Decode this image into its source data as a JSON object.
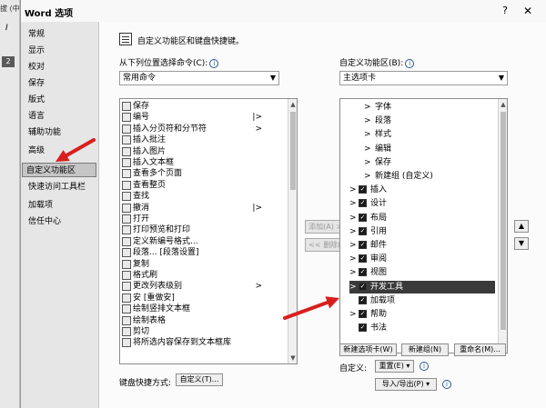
{
  "background_app": {
    "title_fragment": "拔 (中",
    "ruler_mark": "2",
    "side_label": "I"
  },
  "dialog": {
    "title": "Word 选项",
    "help_label": "?",
    "close_label": "✕"
  },
  "nav": {
    "items": [
      {
        "label": "常规"
      },
      {
        "label": "显示"
      },
      {
        "label": "校对"
      },
      {
        "label": "保存"
      },
      {
        "label": "版式"
      },
      {
        "label": "语言"
      },
      {
        "label": "辅助功能"
      },
      {
        "label": "高级"
      },
      {
        "label": "自定义功能区"
      },
      {
        "label": "快速访问工具栏"
      },
      {
        "label": "加载项"
      },
      {
        "label": "信任中心"
      }
    ],
    "active_label": "自定义功能区"
  },
  "main": {
    "header": "自定义功能区和键盘快捷键。",
    "choose_from_label": "从下列位置选择命令(C):",
    "choose_from_value": "常用命令",
    "customize_label": "自定义功能区(B):",
    "customize_value": "主选项卡",
    "info_icon": "i"
  },
  "commands": [
    {
      "label": "保存",
      "sub": ""
    },
    {
      "label": "编号",
      "sub": "|>"
    },
    {
      "label": "插入分页符和分节符",
      "sub": ">"
    },
    {
      "label": "插入批注",
      "sub": ""
    },
    {
      "label": "插入图片",
      "sub": ""
    },
    {
      "label": "插入文本框",
      "sub": ""
    },
    {
      "label": "查看多个页面",
      "sub": ""
    },
    {
      "label": "查看整页",
      "sub": ""
    },
    {
      "label": "查找",
      "sub": ""
    },
    {
      "label": "撤消",
      "sub": "|>"
    },
    {
      "label": "打开",
      "sub": ""
    },
    {
      "label": "打印预览和打印",
      "sub": ""
    },
    {
      "label": "定义新编号格式...",
      "sub": ""
    },
    {
      "label": "段落... [段落设置]",
      "sub": ""
    },
    {
      "label": "复制",
      "sub": ""
    },
    {
      "label": "格式刷",
      "sub": ""
    },
    {
      "label": "更改列表级别",
      "sub": ">"
    },
    {
      "label": "安 [重做安]",
      "sub": ""
    },
    {
      "label": "绘制竖排文本框",
      "sub": ""
    },
    {
      "label": "绘制表格",
      "sub": ""
    },
    {
      "label": "剪切",
      "sub": ""
    },
    {
      "label": "将所选内容保存到文本框库",
      "sub": ""
    }
  ],
  "middle_buttons": {
    "add": "添加(A) >>",
    "remove": "<< 删除(R)"
  },
  "tree": [
    {
      "label": "字体",
      "level": 1,
      "chev": ">",
      "check": false
    },
    {
      "label": "段落",
      "level": 1,
      "chev": ">",
      "check": false
    },
    {
      "label": "样式",
      "level": 1,
      "chev": ">",
      "check": false
    },
    {
      "label": "编辑",
      "level": 1,
      "chev": ">",
      "check": false
    },
    {
      "label": "保存",
      "level": 1,
      "chev": ">",
      "check": false
    },
    {
      "label": "新建组 (自定义)",
      "level": 1,
      "chev": ">",
      "check": false
    },
    {
      "label": "插入",
      "level": 0,
      "chev": ">",
      "check": true
    },
    {
      "label": "设计",
      "level": 0,
      "chev": ">",
      "check": true
    },
    {
      "label": "布局",
      "level": 0,
      "chev": ">",
      "check": true
    },
    {
      "label": "引用",
      "level": 0,
      "chev": ">",
      "check": true
    },
    {
      "label": "邮件",
      "level": 0,
      "chev": ">",
      "check": true
    },
    {
      "label": "审阅",
      "level": 0,
      "chev": ">",
      "check": true
    },
    {
      "label": "视图",
      "level": 0,
      "chev": ">",
      "check": true
    },
    {
      "label": "开发工具",
      "level": 0,
      "chev": ">",
      "check": true,
      "highlight": true
    },
    {
      "label": "加载项",
      "level": 0,
      "chev": "",
      "check": true
    },
    {
      "label": "帮助",
      "level": 0,
      "chev": ">",
      "check": true
    },
    {
      "label": "书法",
      "level": 0,
      "chev": "",
      "check": true
    }
  ],
  "tree_buttons": {
    "new_tab": "新建选项卡(W)",
    "new_group": "新建组(N)",
    "rename": "重命名(M)..."
  },
  "customizations": {
    "label": "自定义:",
    "reset": "重置(E) ▾",
    "import_export": "导入/导出(P) ▾"
  },
  "keyboard": {
    "label": "键盘快捷方式:",
    "button": "自定义(T)..."
  },
  "move_up": "▲",
  "move_down": "▼",
  "colors": {
    "annotation_arrow": "#d81e1e",
    "highlight_row": "#3a3a3a"
  }
}
